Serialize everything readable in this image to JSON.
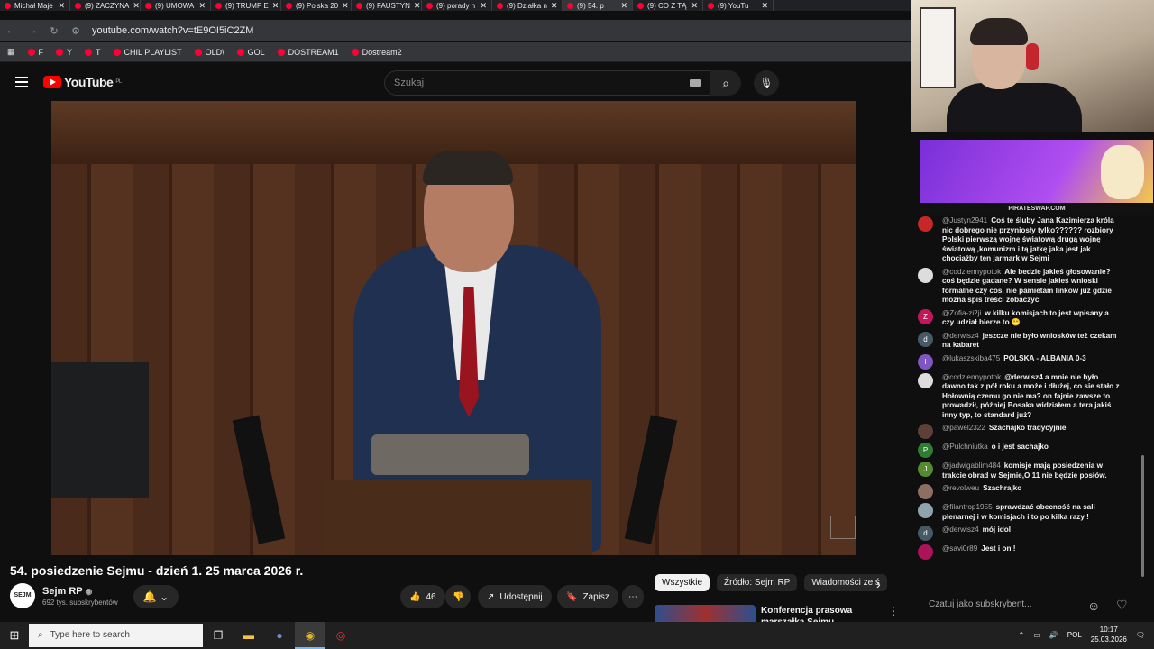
{
  "browser": {
    "tabs": [
      {
        "label": "Michał Maje",
        "active": false
      },
      {
        "label": "(9) ZACZYNA",
        "active": false
      },
      {
        "label": "(9) UMOWA",
        "active": false
      },
      {
        "label": "(9) TRUMP E",
        "active": false
      },
      {
        "label": "(9) Polska 20",
        "active": false
      },
      {
        "label": "(9) FAUSTYN",
        "active": false
      },
      {
        "label": "(9) porady n",
        "active": false
      },
      {
        "label": "(9) Działka n",
        "active": false
      },
      {
        "label": "(9) 54. p",
        "active": true
      },
      {
        "label": "(9) CO Z TĄ",
        "active": false
      },
      {
        "label": "(9) YouTu",
        "active": false
      }
    ],
    "url": "youtube.com/watch?v=tE9OI5iC2ZM",
    "bookmarks": [
      "F",
      "Y",
      "T",
      "CHIL PLAYLIST",
      "OLD\\",
      "GOL",
      "DOSTREAM1",
      "Dostream2"
    ]
  },
  "youtube": {
    "logo_text": "YouTube",
    "logo_region": "PL",
    "search_placeholder": "Szukaj"
  },
  "video": {
    "title": "54. posiedzenie Sejmu - dzień 1. 25 marca 2026 r.",
    "channel_name": "Sejm RP",
    "channel_avatar_text": "SEJM",
    "subscribers": "692 tys. subskrybentów",
    "likes": "46",
    "share_label": "Udostępnij",
    "save_label": "Zapisz"
  },
  "filters": {
    "chips": [
      "Wszystkie",
      "Źródło: Sejm RP",
      "Wiadomości ze ś"
    ]
  },
  "recommendation": {
    "title": "Konferencja prasowa marszałka Sejmu Włodzimierza"
  },
  "ad": {
    "footer": "PIRATESWAP.COM"
  },
  "chat": {
    "messages": [
      {
        "author": "@Justyn2941",
        "text": "Coś te śluby Jana Kazimierza króla nic dobrego nie przyniosły tylko?????? rozbiory Polski pierwszą wojnę światową drugą wojnę światową ,komunizm i tą jatkę jaka jest jak chociażby ten jarmark w Sejmi",
        "avatar": "",
        "color": "#c62828"
      },
      {
        "author": "@codziennypotok",
        "text": "Ale bedzie jakieś głosowanie? coś będzie gadane? W sensie jakieś wnioski formalne czy cos, nie pamietam linkow juz gdzie mozna spis treści zobaczyc",
        "avatar": "",
        "color": "#dddddd"
      },
      {
        "author": "@Zofia-zi2ji",
        "text": "w kilku komisjach to jest wpisany a czy udział bierze to 😬",
        "avatar": "Z",
        "color": "#c2185b"
      },
      {
        "author": "@derwisz4",
        "text": "jeszcze nie było wniosków też czekam na kabaret",
        "avatar": "d",
        "color": "#455a64"
      },
      {
        "author": "@lukaszskiba475",
        "text": "POLSKA - ALBANIA 0-3",
        "avatar": "l",
        "color": "#7e57c2"
      },
      {
        "author": "@codziennypotok",
        "text": "@derwisz4 a mnie nie było dawno tak z pół roku a może i dłużej, co sie stało z Hołownią czemu go nie ma? on fajnie zawsze to prowadził, później Bosaka widziałem a tera jakiś inny typ, to standard już?",
        "avatar": "",
        "color": "#dddddd"
      },
      {
        "author": "@pawel2322",
        "text": "Szachajko tradycyjnie",
        "avatar": "",
        "color": "#5d4037"
      },
      {
        "author": "@Pulchniutka",
        "text": "o i jest sachajko",
        "avatar": "P",
        "color": "#2e7d32"
      },
      {
        "author": "@jadwigablim484",
        "text": "komisje mają posiedzenia w trakcie obrad w Sejmie,O 11 nie będzie posłów.",
        "avatar": "J",
        "color": "#558b2f"
      },
      {
        "author": "@revolweu",
        "text": "Szachrajko",
        "avatar": "",
        "color": "#8d6e63"
      },
      {
        "author": "@filantrop1955",
        "text": "sprawdzać obecność na sali plenarnej i w komisjach i to po kilka razy !",
        "avatar": "",
        "color": "#90a4ae"
      },
      {
        "author": "@derwisz4",
        "text": "mój idol",
        "avatar": "d",
        "color": "#455a64"
      },
      {
        "author": "@savi0r89",
        "text": "Jest i on !",
        "avatar": "",
        "color": "#ad1457"
      }
    ],
    "input_placeholder": "Czatuj jako subskrybent..."
  },
  "taskbar": {
    "search_placeholder": "Type here to search",
    "language": "POL",
    "time": "10:17",
    "date": "25.03.2026"
  }
}
